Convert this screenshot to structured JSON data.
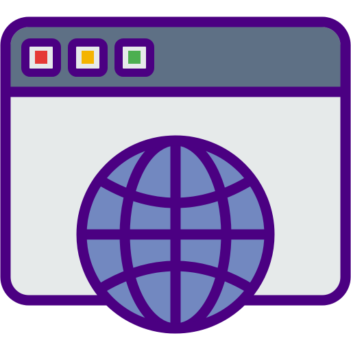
{
  "icon": {
    "name": "browser-globe-icon",
    "colors": {
      "outline": "#4B0082",
      "titlebar": "#5E7085",
      "window_body": "#E6EAEA",
      "globe_fill": "#7288C0",
      "dot_red": "#E53935",
      "dot_yellow": "#F4B400",
      "dot_green": "#4CAF50"
    },
    "window_controls": [
      "red",
      "yellow",
      "green"
    ]
  }
}
